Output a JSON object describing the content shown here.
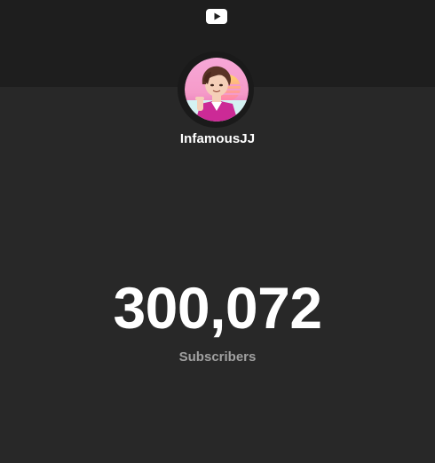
{
  "header": {
    "logo_icon": "youtube-play-icon",
    "logo_color": "#ffffff"
  },
  "channel": {
    "name": "InfamousJJ",
    "avatar_icon": "channel-avatar"
  },
  "stats": {
    "subscriber_count": "300,072",
    "subscriber_label": "Subscribers"
  },
  "colors": {
    "background": "#282828",
    "header_band": "#1e1e1e",
    "primary_text": "#ffffff",
    "secondary_text": "#a0a0a0"
  }
}
